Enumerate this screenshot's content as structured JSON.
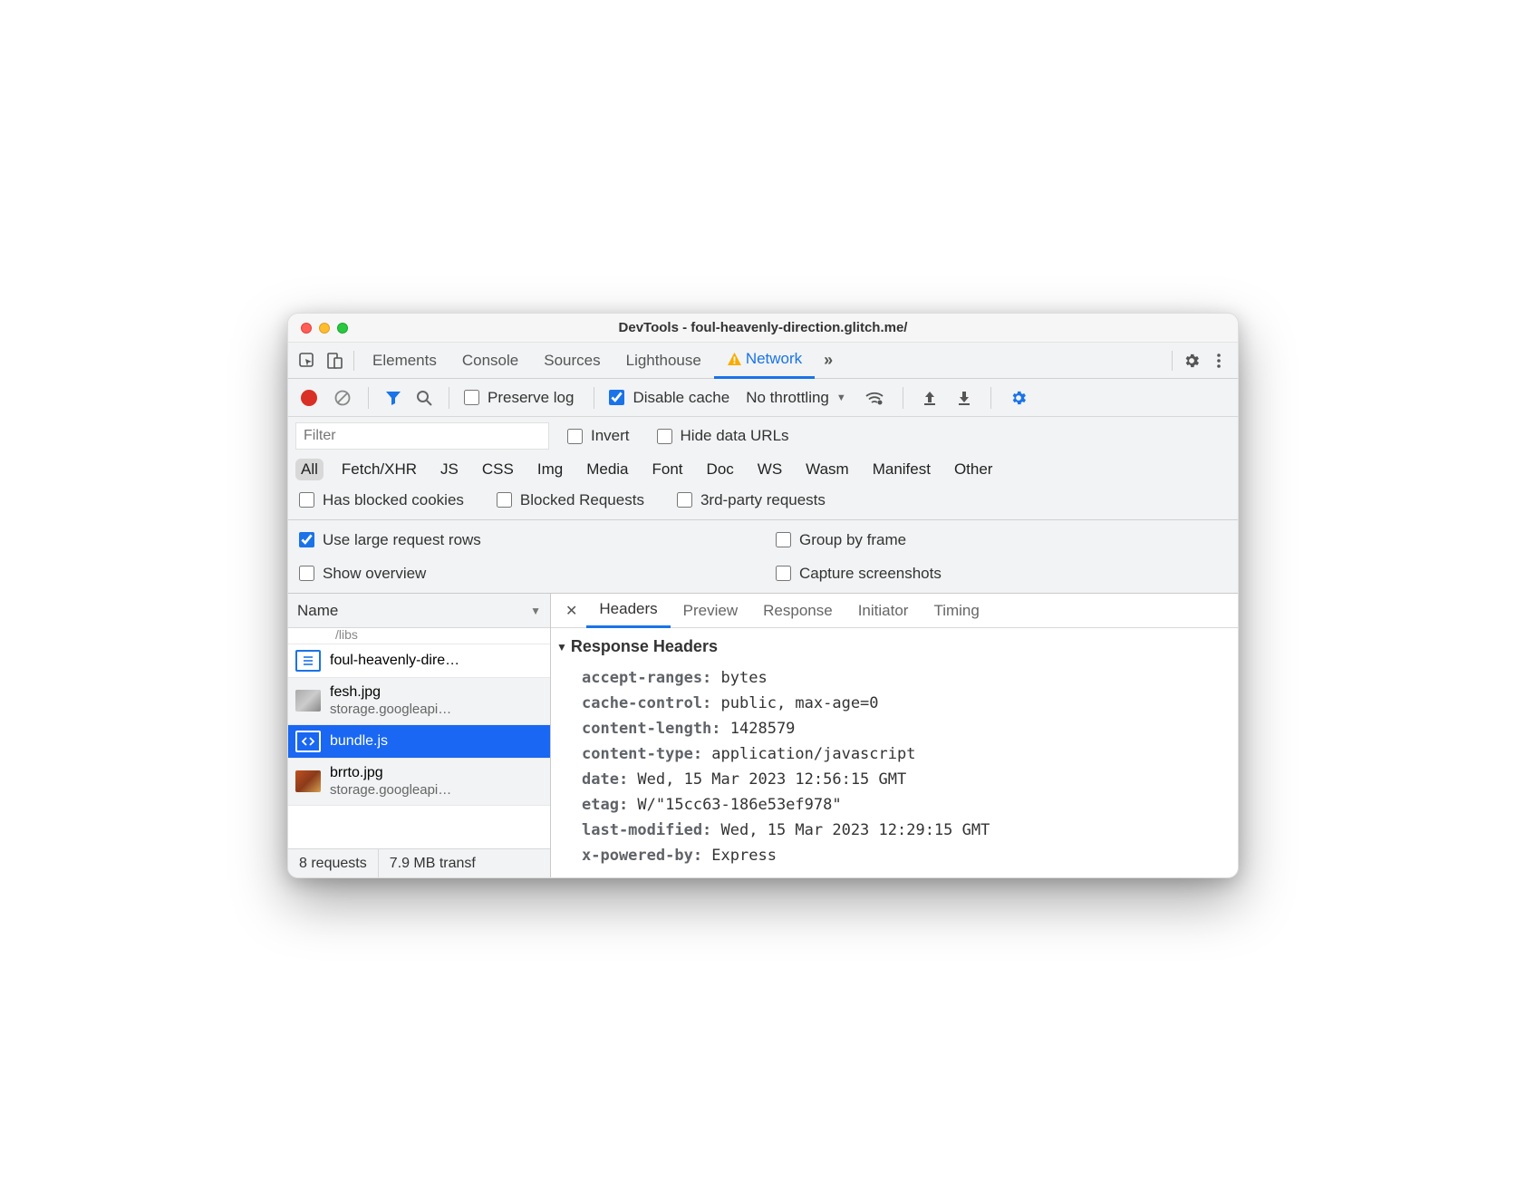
{
  "window": {
    "title": "DevTools - foul-heavenly-direction.glitch.me/"
  },
  "main_tabs": {
    "items": [
      "Elements",
      "Console",
      "Sources",
      "Lighthouse",
      "Network"
    ],
    "active_index": 4,
    "more_glyph": "»"
  },
  "toolbar": {
    "preserve_log": {
      "label": "Preserve log",
      "checked": false
    },
    "disable_cache": {
      "label": "Disable cache",
      "checked": true
    },
    "throttling": "No throttling"
  },
  "filter": {
    "placeholder": "Filter",
    "invert": {
      "label": "Invert",
      "checked": false
    },
    "hide_data_urls": {
      "label": "Hide data URLs",
      "checked": false
    }
  },
  "types": {
    "items": [
      "All",
      "Fetch/XHR",
      "JS",
      "CSS",
      "Img",
      "Media",
      "Font",
      "Doc",
      "WS",
      "Wasm",
      "Manifest",
      "Other"
    ],
    "active_index": 0
  },
  "extra_filters": {
    "blocked_cookies": {
      "label": "Has blocked cookies",
      "checked": false
    },
    "blocked_requests": {
      "label": "Blocked Requests",
      "checked": false
    },
    "third_party": {
      "label": "3rd-party requests",
      "checked": false
    }
  },
  "network_options": {
    "large_rows": {
      "label": "Use large request rows",
      "checked": true
    },
    "group_by_frame": {
      "label": "Group by frame",
      "checked": false
    },
    "show_overview": {
      "label": "Show overview",
      "checked": false
    },
    "capture_screenshots": {
      "label": "Capture screenshots",
      "checked": false
    }
  },
  "requests": {
    "header": "Name",
    "truncated_top": "/libs",
    "items": [
      {
        "name": "foul-heavenly-dire…",
        "sub": "",
        "kind": "doc",
        "selected": false,
        "alt": false
      },
      {
        "name": "fesh.jpg",
        "sub": "storage.googleapi…",
        "kind": "img1",
        "selected": false,
        "alt": true
      },
      {
        "name": "bundle.js",
        "sub": "",
        "kind": "js",
        "selected": true,
        "alt": false
      },
      {
        "name": "brrto.jpg",
        "sub": "storage.googleapi…",
        "kind": "img2",
        "selected": false,
        "alt": true
      }
    ]
  },
  "status": {
    "requests": "8 requests",
    "transfer": "7.9 MB transf"
  },
  "detail_tabs": {
    "items": [
      "Headers",
      "Preview",
      "Response",
      "Initiator",
      "Timing"
    ],
    "active_index": 0
  },
  "response_headers": {
    "title": "Response Headers",
    "items": [
      {
        "k": "accept-ranges:",
        "v": "bytes"
      },
      {
        "k": "cache-control:",
        "v": "public, max-age=0"
      },
      {
        "k": "content-length:",
        "v": "1428579"
      },
      {
        "k": "content-type:",
        "v": "application/javascript"
      },
      {
        "k": "date:",
        "v": "Wed, 15 Mar 2023 12:56:15 GMT"
      },
      {
        "k": "etag:",
        "v": "W/\"15cc63-186e53ef978\""
      },
      {
        "k": "last-modified:",
        "v": "Wed, 15 Mar 2023 12:29:15 GMT"
      },
      {
        "k": "x-powered-by:",
        "v": "Express"
      }
    ]
  }
}
